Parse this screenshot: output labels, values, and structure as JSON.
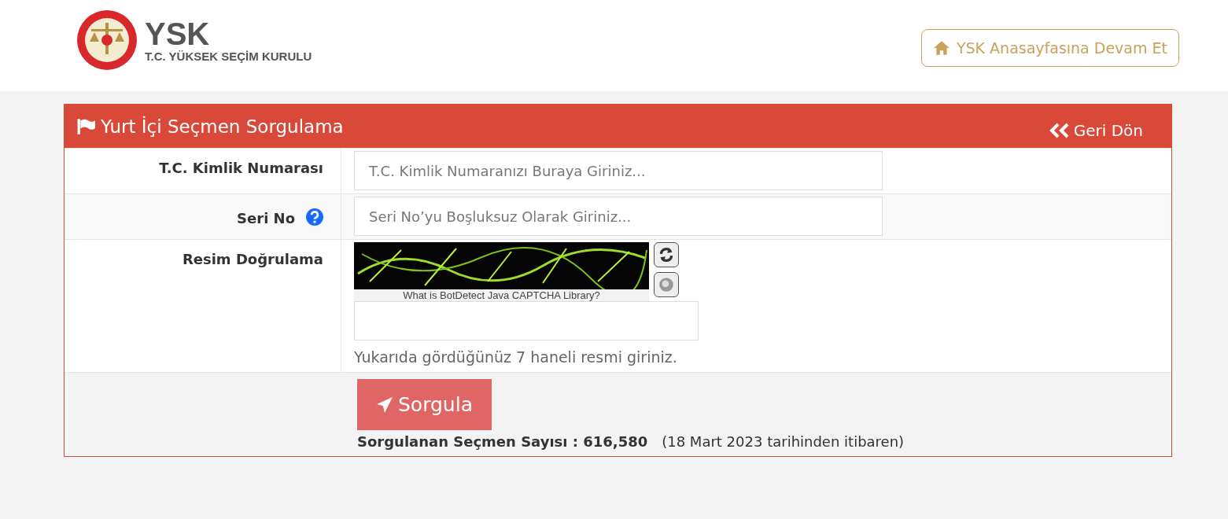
{
  "header": {
    "logo_title": "YSK",
    "logo_subtitle": "T.C. YÜKSEK SEÇİM KURULU",
    "home_link": "YSK Anasayfasına Devam Et"
  },
  "panel": {
    "title": "Yurt İçi Seçmen Sorgulama",
    "back_link": "Geri Dön"
  },
  "form": {
    "rows": [
      {
        "kind": "input",
        "label": "T.C. Kimlik Numarası",
        "help": false,
        "placeholder": "T.C. Kimlik Numaranızı Buraya Giriniz..."
      },
      {
        "kind": "input",
        "label": "Seri No",
        "help": true,
        "placeholder": "Seri No’yu Boşluksuz Olarak Giriniz..."
      },
      {
        "kind": "captcha",
        "label": "Resim Doğrulama",
        "captcha_link": "What is BotDetect Java CAPTCHA Library?",
        "hint": "Yukarıda gördüğünüz 7 haneli resmi giriniz."
      }
    ]
  },
  "submit": {
    "label": "Sorgula"
  },
  "stats": {
    "count_label": "Sorgulanan Seçmen Sayısı : 616,580",
    "since": "(18 Mart 2023 tarihinden itibaren)"
  }
}
